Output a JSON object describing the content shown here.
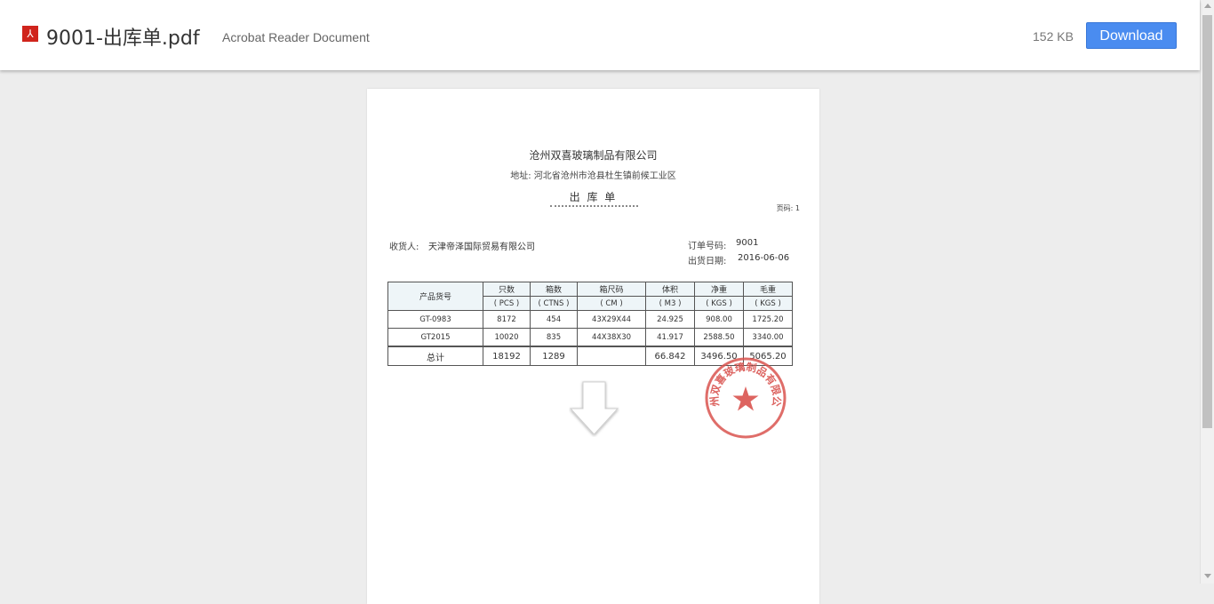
{
  "header": {
    "file_icon": "pdf-icon",
    "file_icon_glyph": "⅄",
    "file_name": "9001-出库单.pdf",
    "file_type": "Acrobat Reader Document",
    "file_size": "152 KB",
    "download_label": "Download",
    "accent_color": "#4a8cf0"
  },
  "document": {
    "company": "沧州双喜玻璃制品有限公司",
    "address": "地址: 河北省沧州市沧县杜生镇前候工业区",
    "title": "出 库 单",
    "page_no": "页码: 1",
    "receiver_label": "收货人:",
    "receiver": "天津帝泽国际贸易有限公司",
    "order_label": "订单号码:",
    "order_no": "9001",
    "ship_label": "出货日期:",
    "ship_date": "2016-06-06",
    "table": {
      "product_header": "产品货号",
      "headers": [
        "只数",
        "箱数",
        "箱尺码",
        "体积",
        "净重",
        "毛重"
      ],
      "units": [
        "( PCS )",
        "( CTNS )",
        "( CM )",
        "( M3 )",
        "( KGS )",
        "( KGS )"
      ],
      "rows": [
        [
          "GT-0983",
          "8172",
          "454",
          "43X29X44",
          "24.925",
          "908.00",
          "1725.20"
        ],
        [
          "GT2015",
          "10020",
          "835",
          "44X38X30",
          "41.917",
          "2588.50",
          "3340.00"
        ]
      ],
      "total": [
        "总计",
        "18192",
        "1289",
        "",
        "66.842",
        "3496.50",
        "5065.20"
      ]
    },
    "seal_text": "沧州双喜玻璃制品有限公司",
    "seal_color": "#d9534f"
  }
}
